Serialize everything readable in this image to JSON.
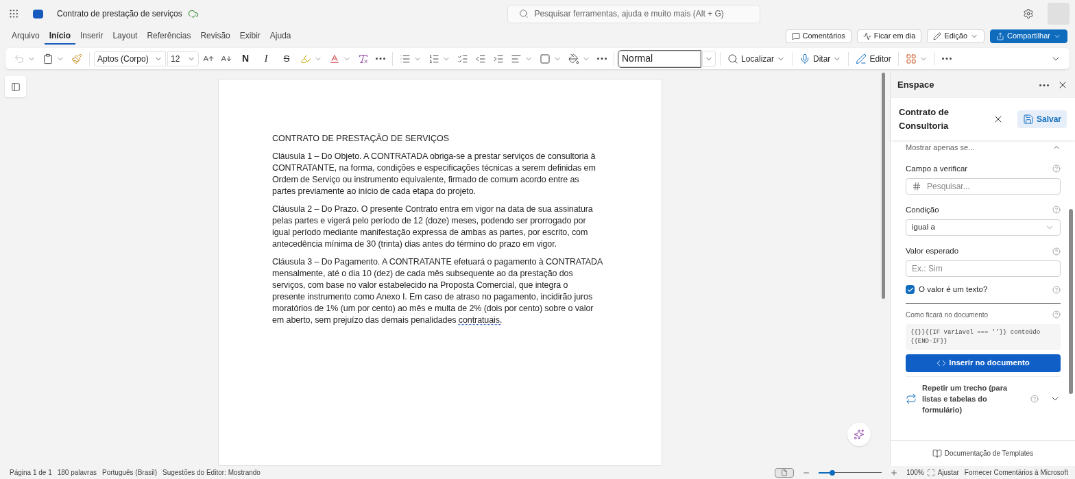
{
  "app_bar": {
    "title": "Contrato de prestação de serviços",
    "search_placeholder": "Pesquisar ferramentas, ajuda e muito mais (Alt + G)"
  },
  "menu_tabs": [
    {
      "label": "Arquivo",
      "selected": false
    },
    {
      "label": "Início",
      "selected": true
    },
    {
      "label": "Inserir",
      "selected": false
    },
    {
      "label": "Layout",
      "selected": false
    },
    {
      "label": "Referências",
      "selected": false
    },
    {
      "label": "Revisão",
      "selected": false
    },
    {
      "label": "Exibir",
      "selected": false
    },
    {
      "label": "Ajuda",
      "selected": false
    }
  ],
  "actions": [
    {
      "kind": "comments",
      "label": "Comentários",
      "menu": false
    },
    {
      "kind": "catchup",
      "label": "Ficar em dia",
      "menu": false
    },
    {
      "kind": "edit",
      "label": "Edição",
      "menu": true
    },
    {
      "kind": "share",
      "label": "Compartilhar",
      "menu": true
    }
  ],
  "toolbar": {
    "font": "Aptos (Corpo)",
    "size": "12",
    "bold": "N",
    "italic": "I",
    "strike": "S",
    "style": "Normal",
    "find": "Localizar",
    "dictate": "Ditar",
    "editor": "Editor"
  },
  "document": {
    "title": "CONTRATO DE PRESTAÇÃO DE SERVIÇOS",
    "paragraphs": [
      {
        "text": "Cláusula 1 – Do Objeto. A CONTRATADA obriga-se a prestar serviços de consultoria à CONTRATANTE, na forma, condições e especificações técnicas a serem definidas em Ordem de Serviço ou instrumento equivalente, firmado de comum acordo entre as partes previamente ao início de cada etapa do projeto."
      },
      {
        "text": "Cláusula 2 – Do Prazo. O presente Contrato entra em vigor na data de sua assinatura pelas partes e vigerá pelo período de 12 (doze) meses, podendo ser prorrogado por igual período mediante manifestação expressa de ambas as partes, por escrito, com antecedência mínima de 30 (trinta) dias antes do término do prazo em vigor."
      },
      {
        "text": "Cláusula 3 – Do Pagamento. A CONTRATANTE efetuará o pagamento à CONTRATADA mensalmente, até o dia 10 (dez) de cada mês subsequente ao da prestação dos serviços, com base no valor estabelecido na Proposta Comercial, que integra o presente instrumento como Anexo I. Em caso de atraso no pagamento, incidirão juros moratórios de 1% (um por cento) ao mês e multa de 2% (dois por cento) sobre o valor em aberto, sem prejuízo das demais penalidades",
        "flagged": "contratuais."
      }
    ]
  },
  "side_panel": {
    "title": "Enspace",
    "template": "Contrato de Consultoria",
    "save": "Salvar",
    "section": "Mostrar apenas se...",
    "fields": [
      {
        "kind": "search",
        "label": "Campo a verificar",
        "placeholder": "Pesquisar..."
      },
      {
        "kind": "select",
        "label": "Condição",
        "value": "igual a"
      },
      {
        "kind": "text",
        "label": "Valor esperado",
        "placeholder": "Ex.: Sim"
      },
      {
        "kind": "checkbox",
        "label": "O valor é um texto?",
        "checked": true
      }
    ],
    "preview_label": "Como ficará no documento",
    "preview_code": "{{}}{{IF variavel === ''}} conteúdo {{END-IF}}",
    "insert": "Inserir no documento",
    "repeat": {
      "label": "Repetir um trecho (para listas e tabelas do formulário)",
      "expanded": false
    },
    "footer_link": "Documentação de Templates"
  },
  "status_bar": {
    "items": [
      "Página 1 de 1",
      "180 palavras",
      "Português (Brasil)",
      "Sugestões do Editor: Mostrando"
    ],
    "zoom": {
      "level": 0.22
    },
    "zoom_reading": "100%",
    "fit": "Ajustar",
    "feedback": "Fornecer Comentários à Microsoft"
  }
}
